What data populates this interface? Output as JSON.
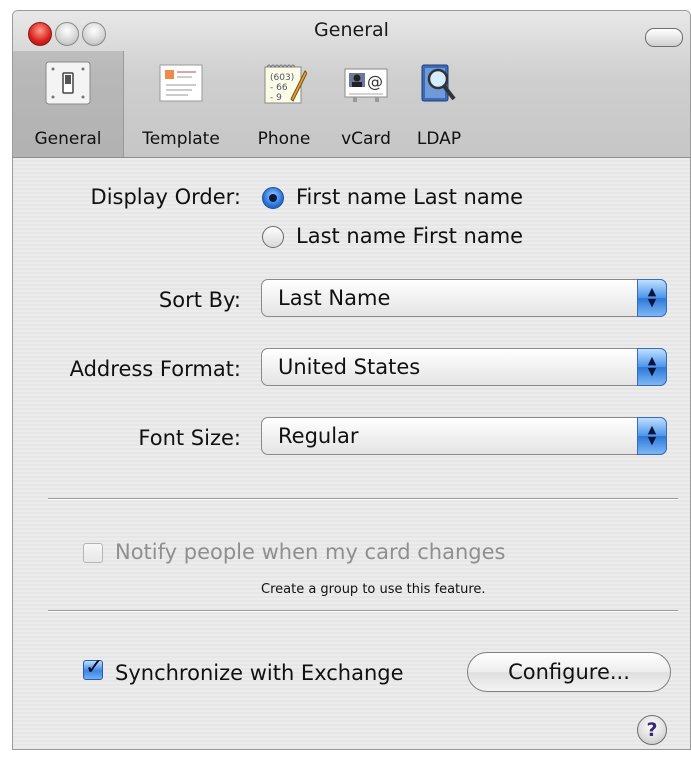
{
  "window": {
    "title": "General"
  },
  "toolbar": {
    "tabs": [
      {
        "label": "General",
        "icon": "light-switch-icon",
        "selected": true
      },
      {
        "label": "Template",
        "icon": "template-card-icon",
        "selected": false
      },
      {
        "label": "Phone",
        "icon": "phone-notepad-icon",
        "selected": false
      },
      {
        "label": "vCard",
        "icon": "vcard-icon",
        "selected": false
      },
      {
        "label": "LDAP",
        "icon": "ldap-search-icon",
        "selected": false
      }
    ]
  },
  "display_order": {
    "label": "Display Order:",
    "options": [
      {
        "label": "First name Last name",
        "selected": true
      },
      {
        "label": "Last name First name",
        "selected": false
      }
    ]
  },
  "sort_by": {
    "label": "Sort By:",
    "value": "Last Name"
  },
  "address_format": {
    "label": "Address Format:",
    "value": "United States"
  },
  "font_size": {
    "label": "Font Size:",
    "value": "Regular"
  },
  "notify": {
    "label": "Notify people when my card changes",
    "checked": false,
    "enabled": false,
    "hint": "Create a group to use this feature."
  },
  "sync": {
    "label": "Synchronize with Exchange",
    "checked": true
  },
  "configure_button": {
    "label": "Configure..."
  },
  "help_button": {
    "label": "?"
  },
  "colors": {
    "accent": "#2f77d8",
    "close_button": "#d8201a"
  }
}
